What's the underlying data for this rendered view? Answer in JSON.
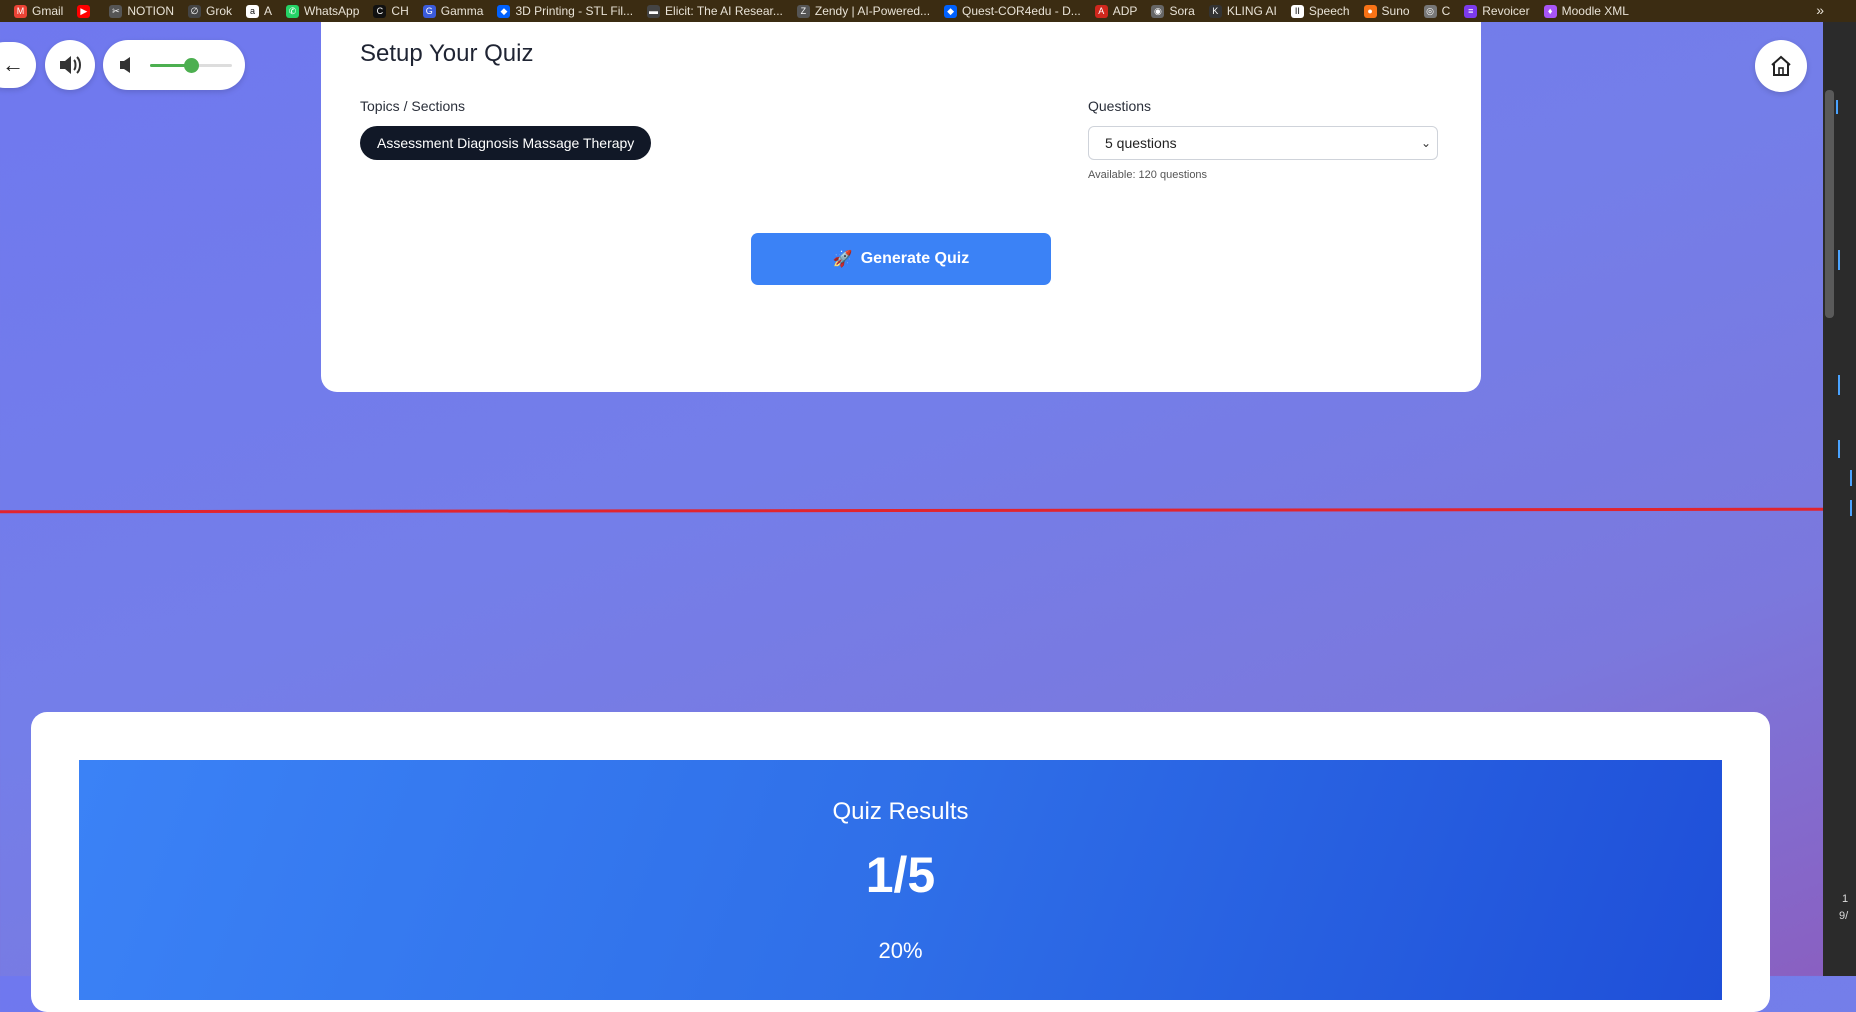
{
  "bookmarks": [
    {
      "label": "Gmail",
      "icon": "gmail-icon",
      "color": "#ea4335",
      "glyph": "M"
    },
    {
      "label": "",
      "icon": "youtube-icon",
      "color": "#ff0000",
      "glyph": "▶"
    },
    {
      "label": "NOTION",
      "icon": "notion-icon",
      "color": "#555555",
      "glyph": "✂"
    },
    {
      "label": "Grok",
      "icon": "grok-icon",
      "color": "#444444",
      "glyph": "∅"
    },
    {
      "label": "A",
      "icon": "amazon-icon",
      "color": "#ffffff",
      "glyph": "a"
    },
    {
      "label": "WhatsApp",
      "icon": "whatsapp-icon",
      "color": "#25d366",
      "glyph": "✆"
    },
    {
      "label": "CH",
      "icon": "ch-icon",
      "color": "#111111",
      "glyph": "C"
    },
    {
      "label": "Gamma",
      "icon": "gamma-icon",
      "color": "#3b5bdb",
      "glyph": "G"
    },
    {
      "label": "3D Printing - STL Fil...",
      "icon": "dropbox-icon",
      "color": "#0061ff",
      "glyph": "◆"
    },
    {
      "label": "Elicit: The AI Resear...",
      "icon": "elicit-icon",
      "color": "#444444",
      "glyph": "▬"
    },
    {
      "label": "Zendy | AI-Powered...",
      "icon": "zendy-icon",
      "color": "#555555",
      "glyph": "Z"
    },
    {
      "label": "Quest-COR4edu - D...",
      "icon": "dropbox-icon",
      "color": "#0061ff",
      "glyph": "◆"
    },
    {
      "label": "ADP",
      "icon": "adp-icon",
      "color": "#d0271d",
      "glyph": "A"
    },
    {
      "label": "Sora",
      "icon": "sora-icon",
      "color": "#666666",
      "glyph": "◉"
    },
    {
      "label": "KLING AI",
      "icon": "kling-icon",
      "color": "#333333",
      "glyph": "K"
    },
    {
      "label": "Speech",
      "icon": "speech-icon",
      "color": "#ffffff",
      "glyph": "II"
    },
    {
      "label": "Suno",
      "icon": "suno-icon",
      "color": "#f97316",
      "glyph": "●"
    },
    {
      "label": "C",
      "icon": "openai-icon",
      "color": "#777777",
      "glyph": "◎"
    },
    {
      "label": "Revoicer",
      "icon": "revoicer-icon",
      "color": "#7c3aed",
      "glyph": "≡"
    },
    {
      "label": "Moodle XML",
      "icon": "moodle-icon",
      "color": "#a855f7",
      "glyph": "♦"
    }
  ],
  "bookmarks_more": "»",
  "controls": {
    "back_glyph": "←",
    "volume_level": 0.5,
    "accent": "#4caf50"
  },
  "setup": {
    "title": "Setup Your Quiz",
    "topics_label": "Topics / Sections",
    "topic_chip": "Assessment Diagnosis Massage Therapy",
    "questions_label": "Questions",
    "questions_value": "5 questions",
    "available_text": "Available: 120 questions",
    "generate_label": "Generate Quiz",
    "generate_color": "#3b82f6"
  },
  "results": {
    "title": "Quiz Results",
    "score": "1/5",
    "percent": "20%"
  },
  "scrollbar_text": {
    "line1": "1",
    "line2": "9/"
  }
}
